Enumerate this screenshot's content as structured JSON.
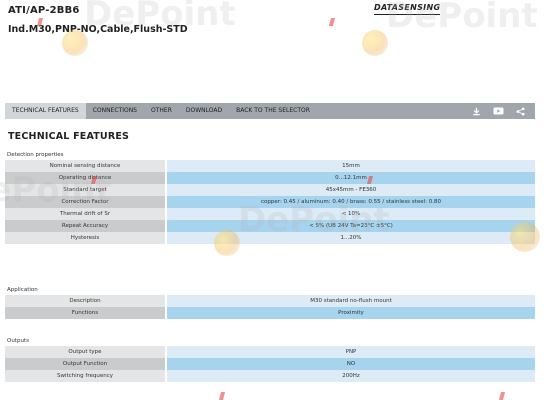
{
  "product": {
    "code": "ATI/AP-2BB6",
    "description": "Ind.M30,PNP-NO,Cable,Flush-STD"
  },
  "brand": {
    "name": "DATASENSING"
  },
  "tabs": [
    {
      "label": "TECHNICAL FEATURES",
      "active": true
    },
    {
      "label": "CONNECTIONS",
      "active": false
    },
    {
      "label": "OTHER",
      "active": false
    },
    {
      "label": "DOWNLOAD",
      "active": false
    },
    {
      "label": "BACK TO THE SELECTOR",
      "active": false
    }
  ],
  "tab_icons": [
    "download-icon",
    "video-icon",
    "share-icon"
  ],
  "section_title": "TECHNICAL FEATURES",
  "groups": [
    {
      "title": "Detection properties",
      "rows": [
        {
          "label": "Nominal sensing distance",
          "value": "15mm"
        },
        {
          "label": "Operating distance",
          "value": "0...12.1mm"
        },
        {
          "label": "Standard target",
          "value": "45x45mm - FE360"
        },
        {
          "label": "Correction Factor",
          "value": "copper: 0.45 / aluminum: 0.40 / brass: 0.55 / stainless steel: 0.80"
        },
        {
          "label": "Thermal drift of Sr",
          "value": "< 10%"
        },
        {
          "label": "Repeat Accuracy",
          "value": "< 5% (UB 24V Ta=23°C ±5°C)"
        },
        {
          "label": "Hysteresis",
          "value": "1...20%"
        }
      ]
    },
    {
      "title": "Application",
      "rows": [
        {
          "label": "Description",
          "value": "M30 standard no-flush mount"
        },
        {
          "label": "Functions",
          "value": "Proximity"
        }
      ]
    },
    {
      "title": "Outputs",
      "rows": [
        {
          "label": "Output type",
          "value": "PNP"
        },
        {
          "label": "Output Function",
          "value": "NO"
        },
        {
          "label": "Switching frequency",
          "value": "200Hz"
        }
      ]
    }
  ],
  "watermark": "DePoint",
  "colors": {
    "tabbar": "#a0a6ab",
    "tab_active": "#d3d6d9",
    "label_light": "#e4e5e6",
    "label_dark": "#cacbcd",
    "value_light": "#dcebf6",
    "value_dark": "#a6d3ee"
  }
}
